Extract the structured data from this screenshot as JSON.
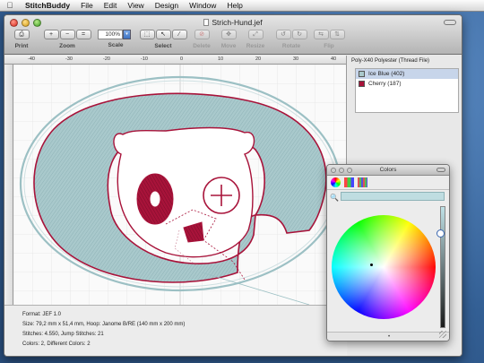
{
  "menubar": {
    "apple": "",
    "app_name": "StitchBuddy",
    "items": [
      "File",
      "Edit",
      "View",
      "Design",
      "Window",
      "Help"
    ]
  },
  "window": {
    "title": "Strich-Hund.jef"
  },
  "toolbar": {
    "print_label": "Print",
    "zoom_label": "Zoom",
    "zoom_in": "+",
    "zoom_out": "−",
    "zoom_fit": "=",
    "scale_label": "Scale",
    "scale_value": "100%",
    "select_label": "Select",
    "delete_label": "Delete",
    "move_label": "Move",
    "resize_label": "Resize",
    "rotate_label": "Rotate",
    "flip_label": "Flip"
  },
  "ruler": {
    "labels": [
      "-40",
      "-30",
      "-20",
      "-10",
      "0",
      "10",
      "20",
      "30",
      "40"
    ]
  },
  "info": {
    "format": "Format: JEF 1.0",
    "size": "Size: 79,2 mm x 51,4 mm, Hoop: Janome B/RE (140 mm x 200 mm)",
    "stitches": "Stitches: 4.550, Jump Stitches: 21",
    "colors": "Colors: 2, Different Colors: 2"
  },
  "threads": {
    "header": "Poly-X40 Polyester (Thread File)",
    "items": [
      {
        "label": "Ice Blue (402)",
        "color": "#a9c9cc"
      },
      {
        "label": "Cherry (187)",
        "color": "#a8133a"
      }
    ]
  },
  "colors_panel": {
    "title": "Colors",
    "field_color": "#bfdde1",
    "bottom_glyph": "•"
  },
  "palette": {
    "ice_blue": "#a9c9cc",
    "cherry": "#a8133a"
  }
}
